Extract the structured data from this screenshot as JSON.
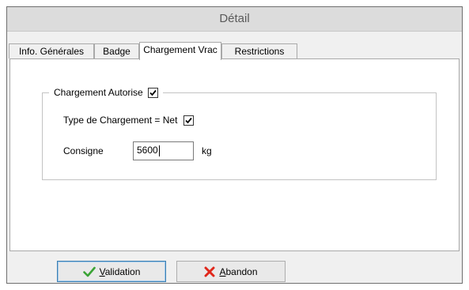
{
  "window": {
    "title": "Détail"
  },
  "tabs": [
    {
      "label": "Info. Générales",
      "active": false
    },
    {
      "label": "Badge",
      "active": false
    },
    {
      "label": "Chargement Vrac",
      "active": true
    },
    {
      "label": "Restrictions",
      "active": false
    }
  ],
  "panel": {
    "group": {
      "label": "Chargement Autorise",
      "checked": true
    },
    "type_row": {
      "label": "Type de Chargement = Net",
      "checked": true
    },
    "consigne": {
      "label": "Consigne",
      "value": "5600",
      "unit": "kg"
    }
  },
  "buttons": {
    "validation": {
      "accel": "V",
      "rest": "alidation",
      "icon": "check-icon",
      "color": "#3aa335"
    },
    "abandon": {
      "accel": "A",
      "rest": "bandon",
      "icon": "x-icon",
      "color": "#e0271b"
    }
  }
}
